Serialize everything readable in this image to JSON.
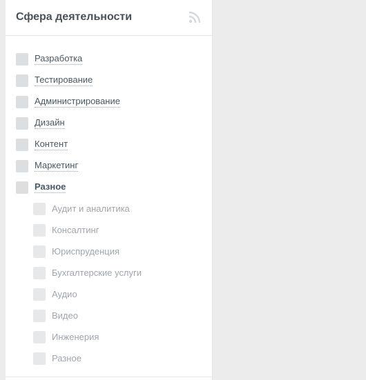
{
  "panel": {
    "title": "Сфера деятельности",
    "icon": "rss-icon",
    "categories": [
      {
        "label": "Разработка"
      },
      {
        "label": "Тестирование"
      },
      {
        "label": "Администрирование"
      },
      {
        "label": "Дизайн"
      },
      {
        "label": "Контент"
      },
      {
        "label": "Маркетинг"
      },
      {
        "label": "Разное"
      }
    ],
    "subcategories": [
      {
        "label": "Аудит и аналитика"
      },
      {
        "label": "Консалтинг"
      },
      {
        "label": "Юриспруденция"
      },
      {
        "label": "Бухгалтерские услуги"
      },
      {
        "label": "Аудио"
      },
      {
        "label": "Видео"
      },
      {
        "label": "Инженерия"
      },
      {
        "label": "Разное"
      }
    ]
  }
}
